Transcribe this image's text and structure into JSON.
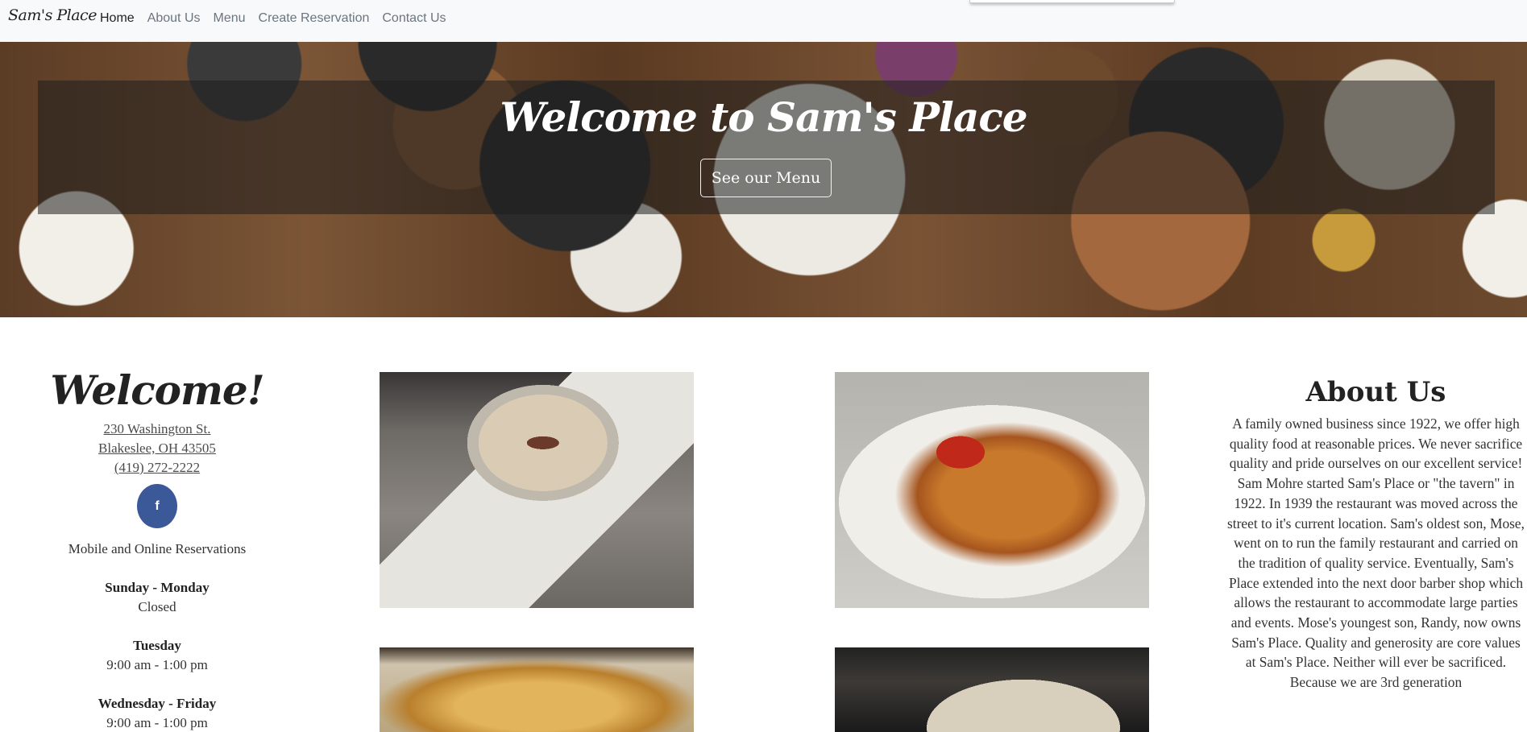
{
  "navbar": {
    "brand": "Sam's Place",
    "links": [
      {
        "label": "Home"
      },
      {
        "label": "About Us"
      },
      {
        "label": "Menu"
      },
      {
        "label": "Create Reservation"
      },
      {
        "label": "Contact Us"
      }
    ]
  },
  "hero": {
    "title": "Welcome to Sam's Place",
    "button_label": "See our Menu"
  },
  "welcome": {
    "title": "Welcome!",
    "address_line1": "230 Washington St.",
    "address_line2": "Blakeslee, OH 43505",
    "phone": "(419) 272-2222",
    "facebook_glyph": "f",
    "reservations": "Mobile and Online Reservations",
    "hours": [
      {
        "day": "Sunday - Monday",
        "time": "Closed"
      },
      {
        "day": "Tuesday",
        "time": "9:00 am - 1:00 pm"
      },
      {
        "day": "Wednesday - Friday",
        "time": "9:00 am - 1:00 pm"
      }
    ]
  },
  "about": {
    "title": "About Us",
    "text": "A family owned business since 1922, we offer high quality food at reasonable prices. We never sacrifice quality and pride ourselves on our excellent service! Sam Mohre started Sam's Place or \"the tavern\" in 1922. In 1939 the restaurant was moved across the street to it's current location. Sam's oldest son, Mose, went on to run the family restaurant and carried on the tradition of quality service. Eventually, Sam's Place extended into the next door barber shop which allows the restaurant to accommodate large parties and events. Mose's youngest son, Randy, now owns Sam's Place. Quality and generosity are core values at Sam's Place. Neither will ever be sacrificed. Because we are 3rd generation"
  },
  "colors": {
    "navbar_bg": "#f8f9fa",
    "facebook_blue": "#3b5998"
  }
}
